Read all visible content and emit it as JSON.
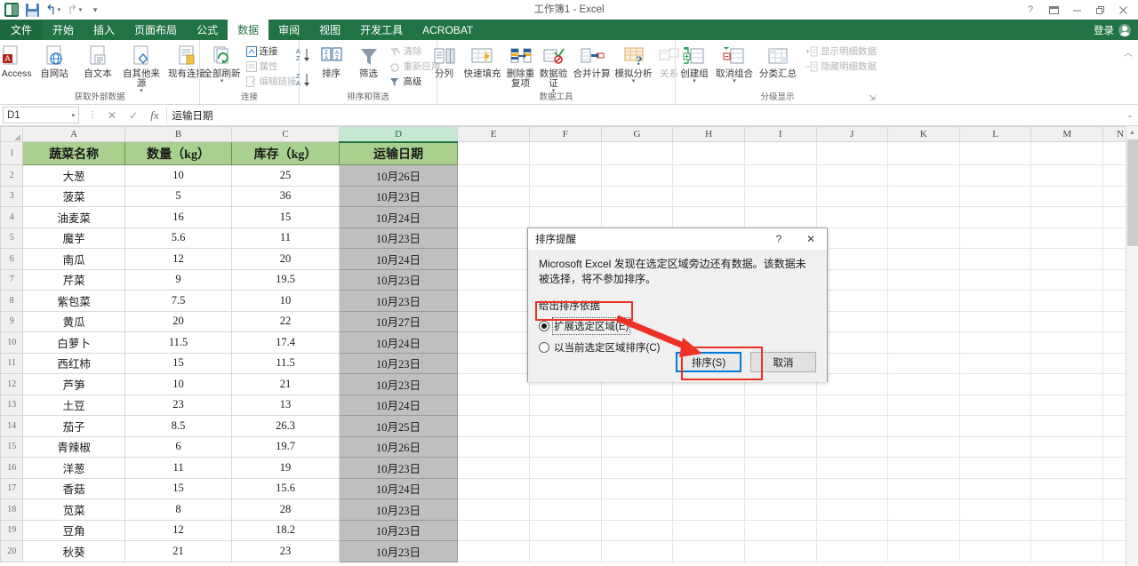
{
  "titlebar": {
    "document_title": "工作簿1 - Excel",
    "quick_access": [
      {
        "name": "excel-logo",
        "label": ""
      },
      {
        "name": "save",
        "label": "保存"
      },
      {
        "name": "undo",
        "label": "撤消"
      },
      {
        "name": "redo",
        "label": "恢复"
      },
      {
        "name": "customize-qat",
        "label": "自定义快速访问工具栏"
      }
    ],
    "window_controls": [
      {
        "name": "help",
        "glyph": "?"
      },
      {
        "name": "ribbon-display-options",
        "glyph": "▭"
      },
      {
        "name": "minimize",
        "glyph": "—"
      },
      {
        "name": "restore",
        "glyph": "❐"
      },
      {
        "name": "close",
        "glyph": "✕"
      }
    ],
    "signin_label": "登录"
  },
  "tabs": [
    {
      "label": "文件",
      "active": false,
      "file": true
    },
    {
      "label": "开始",
      "active": false
    },
    {
      "label": "插入",
      "active": false
    },
    {
      "label": "页面布局",
      "active": false
    },
    {
      "label": "公式",
      "active": false
    },
    {
      "label": "数据",
      "active": true
    },
    {
      "label": "审阅",
      "active": false
    },
    {
      "label": "视图",
      "active": false
    },
    {
      "label": "开发工具",
      "active": false
    },
    {
      "label": "ACROBAT",
      "active": false
    }
  ],
  "ribbon": {
    "collapse_label": "︿",
    "groups": [
      {
        "label": "获取外部数据",
        "big_buttons": [
          {
            "label": "自 Access",
            "icon": "access-icon",
            "caret": false
          },
          {
            "label": "自网站",
            "icon": "web-icon",
            "caret": false
          },
          {
            "label": "自文本",
            "icon": "text-icon",
            "caret": false
          },
          {
            "label": "自其他来源",
            "icon": "other-sources-icon",
            "caret": true
          },
          {
            "label": "现有连接",
            "icon": "existing-connections-icon",
            "caret": false
          }
        ]
      },
      {
        "label": "连接",
        "big_buttons": [
          {
            "label": "全部刷新",
            "icon": "refresh-all-icon",
            "caret": true
          }
        ],
        "small_buttons": [
          {
            "label": "连接",
            "icon": "connections-icon",
            "disabled": false
          },
          {
            "label": "属性",
            "icon": "properties-icon",
            "disabled": true
          },
          {
            "label": "编辑链接",
            "icon": "edit-links-icon",
            "disabled": true
          }
        ]
      },
      {
        "label": "排序和筛选",
        "sort_buttons": [
          {
            "label": "升序",
            "icon": "sort-az-icon"
          },
          {
            "label": "降序",
            "icon": "sort-za-icon"
          }
        ],
        "big_buttons": [
          {
            "label": "排序",
            "icon": "sort-icon",
            "caret": false
          },
          {
            "label": "筛选",
            "icon": "filter-icon",
            "caret": false
          }
        ],
        "small_buttons": [
          {
            "label": "清除",
            "icon": "clear-filter-icon",
            "disabled": true
          },
          {
            "label": "重新应用",
            "icon": "reapply-icon",
            "disabled": true
          },
          {
            "label": "高级",
            "icon": "advanced-filter-icon",
            "disabled": false
          }
        ]
      },
      {
        "label": "数据工具",
        "big_buttons": [
          {
            "label": "分列",
            "icon": "text-to-columns-icon",
            "caret": false
          },
          {
            "label": "快速填充",
            "icon": "flash-fill-icon",
            "caret": false
          },
          {
            "label": "删除重复项",
            "icon": "remove-duplicates-icon",
            "caret": false
          },
          {
            "label": "数据验证",
            "icon": "data-validation-icon",
            "caret": true
          },
          {
            "label": "合并计算",
            "icon": "consolidate-icon",
            "caret": false
          },
          {
            "label": "模拟分析",
            "icon": "what-if-icon",
            "caret": true
          },
          {
            "label": "关系",
            "icon": "relationships-icon",
            "caret": false,
            "disabled": true
          }
        ]
      },
      {
        "label": "分级显示",
        "big_buttons": [
          {
            "label": "创建组",
            "icon": "group-icon",
            "caret": true
          },
          {
            "label": "取消组合",
            "icon": "ungroup-icon",
            "caret": true
          },
          {
            "label": "分类汇总",
            "icon": "subtotal-icon",
            "caret": false
          }
        ],
        "small_buttons": [
          {
            "label": "显示明细数据",
            "icon": "show-detail-icon",
            "disabled": true
          },
          {
            "label": "隐藏明细数据",
            "icon": "hide-detail-icon",
            "disabled": true
          }
        ],
        "dialog_launcher": "⇲"
      }
    ]
  },
  "formula_bar": {
    "name_box_value": "D1",
    "cancel_icon": "✕",
    "enter_icon": "✓",
    "function_icon": "fx",
    "content": "运输日期",
    "expand_icon": "⌄"
  },
  "sheet": {
    "columns": [
      "A",
      "B",
      "C",
      "D",
      "E",
      "F",
      "G",
      "H",
      "I",
      "J",
      "K",
      "L",
      "M",
      "N"
    ],
    "selected_column": "D",
    "row_numbers": [
      1,
      2,
      3,
      4,
      5,
      6,
      7,
      8,
      9,
      10,
      11,
      12,
      13,
      14,
      15,
      16,
      17,
      18,
      19,
      20
    ],
    "headers": [
      "蔬菜名称",
      "数量（kg）",
      "库存（kg）",
      "运输日期"
    ],
    "rows": [
      [
        "大葱",
        "10",
        "25",
        "10月26日"
      ],
      [
        "菠菜",
        "5",
        "36",
        "10月23日"
      ],
      [
        "油麦菜",
        "16",
        "15",
        "10月24日"
      ],
      [
        "魔芋",
        "5.6",
        "11",
        "10月23日"
      ],
      [
        "南瓜",
        "12",
        "20",
        "10月24日"
      ],
      [
        "芹菜",
        "9",
        "19.5",
        "10月23日"
      ],
      [
        "紫包菜",
        "7.5",
        "10",
        "10月23日"
      ],
      [
        "黄瓜",
        "20",
        "22",
        "10月27日"
      ],
      [
        "白萝卜",
        "11.5",
        "17.4",
        "10月24日"
      ],
      [
        "西红柿",
        "15",
        "11.5",
        "10月23日"
      ],
      [
        "芦笋",
        "10",
        "21",
        "10月23日"
      ],
      [
        "土豆",
        "23",
        "13",
        "10月24日"
      ],
      [
        "茄子",
        "8.5",
        "26.3",
        "10月25日"
      ],
      [
        "青辣椒",
        "6",
        "19.7",
        "10月26日"
      ],
      [
        "洋葱",
        "11",
        "19",
        "10月23日"
      ],
      [
        "香菇",
        "15",
        "15.6",
        "10月24日"
      ],
      [
        "苋菜",
        "8",
        "28",
        "10月23日"
      ],
      [
        "豆角",
        "12",
        "18.2",
        "10月23日"
      ],
      [
        "秋葵",
        "21",
        "23",
        "10月23日"
      ]
    ]
  },
  "dialog": {
    "title": "排序提醒",
    "help_glyph": "?",
    "close_glyph": "✕",
    "message": "Microsoft Excel 发现在选定区域旁边还有数据。该数据未被选择，将不参加排序。",
    "group_label": "给出排序依据",
    "options": [
      {
        "label": "扩展选定区域(E)",
        "selected": true
      },
      {
        "label": "以当前选定区域排序(C)",
        "selected": false
      }
    ],
    "buttons": [
      {
        "label": "排序(S)",
        "default": true
      },
      {
        "label": "取消",
        "default": false
      }
    ]
  },
  "annotations": {
    "highlight_color": "#ee3124",
    "boxes": [
      "option-extend-selection",
      "sort-button"
    ],
    "arrow": "red-arrow-pointing-to-sort-button"
  }
}
